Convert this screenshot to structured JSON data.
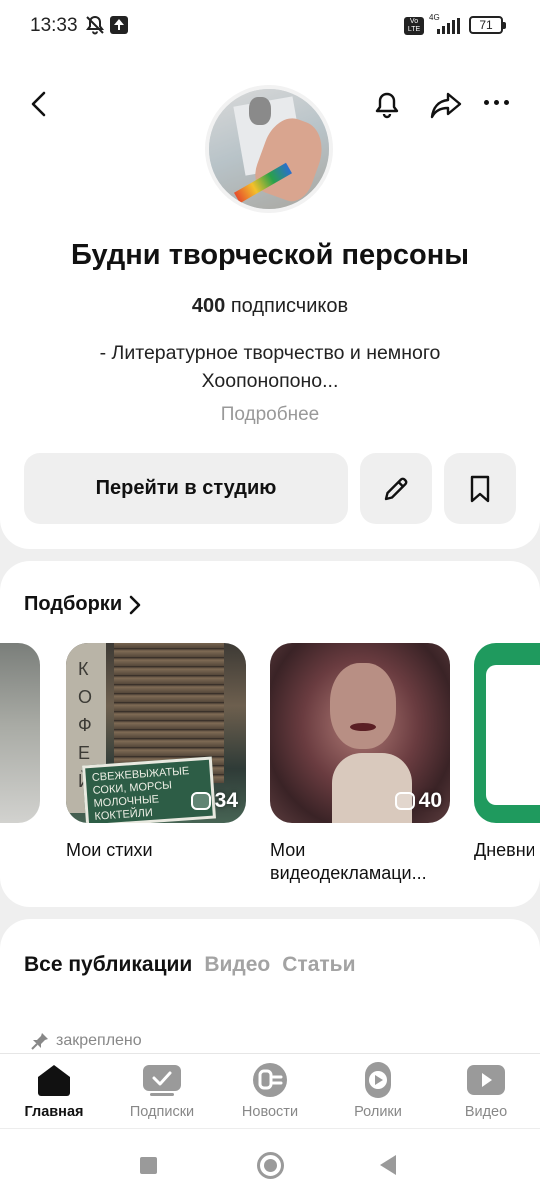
{
  "status_bar": {
    "time": "13:33",
    "volte": "Vo LTE",
    "network": "4G",
    "battery": "71"
  },
  "profile": {
    "title": "Будни творческой персоны",
    "subscribers_count": "400",
    "subscribers_label": "подписчиков",
    "description": "- Литературное творчество и немного Хоопонопоно...",
    "more_link": "Подробнее",
    "studio_button": "Перейти в студию"
  },
  "collections": {
    "title": "Подборки",
    "items": [
      {
        "label": "Мои стихи",
        "count": "34",
        "image_text": "КОФЕЙ",
        "board_text": "СВЕЖЕВЫЖАТЫЕ СОКИ, МОРСЫ МОЛОЧНЫЕ КОКТЕЙЛИ"
      },
      {
        "label": "Мои видеодекламаци...",
        "count": "40"
      },
      {
        "label": "Дневник инве..."
      }
    ]
  },
  "publications": {
    "tabs": [
      "Все публикации",
      "Видео",
      "Статьи"
    ],
    "pinned_label": "закреплено"
  },
  "bottom_nav": [
    {
      "label": "Главная",
      "active": true
    },
    {
      "label": "Подписки",
      "active": false
    },
    {
      "label": "Новости",
      "active": false
    },
    {
      "label": "Ролики",
      "active": false
    },
    {
      "label": "Видео",
      "active": false
    }
  ],
  "colors": {
    "background": "#efefef",
    "card": "#ffffff",
    "muted": "#999999",
    "accent_green": "#1f9a5e"
  }
}
